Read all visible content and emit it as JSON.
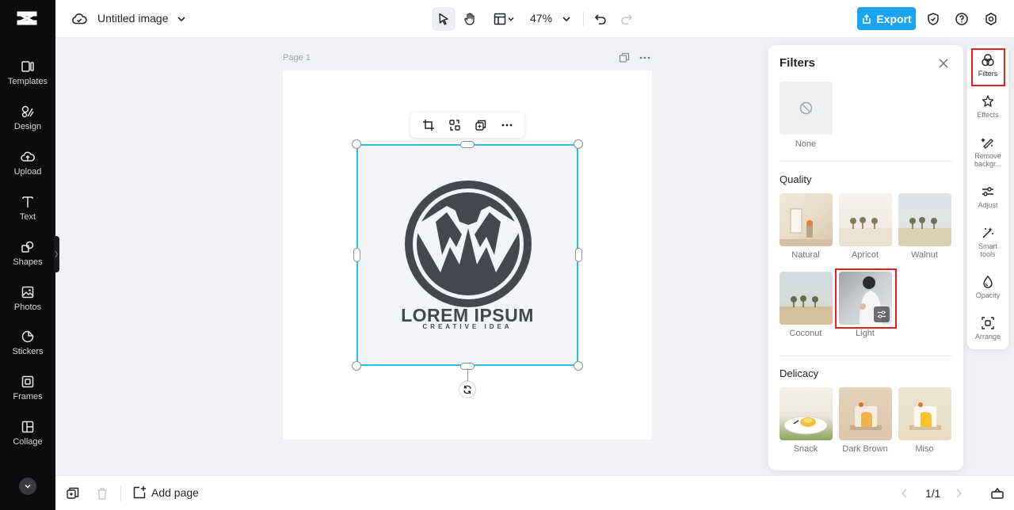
{
  "app": {
    "title": "Untitled image",
    "zoom": "47%",
    "export_label": "Export",
    "accent": "#1ba4f0"
  },
  "sidebar": {
    "items": [
      {
        "label": "Templates",
        "icon": "templates-icon"
      },
      {
        "label": "Design",
        "icon": "design-icon"
      },
      {
        "label": "Upload",
        "icon": "upload-icon"
      },
      {
        "label": "Text",
        "icon": "text-icon"
      },
      {
        "label": "Shapes",
        "icon": "shapes-icon"
      },
      {
        "label": "Photos",
        "icon": "photos-icon"
      },
      {
        "label": "Stickers",
        "icon": "stickers-icon"
      },
      {
        "label": "Frames",
        "icon": "frames-icon"
      },
      {
        "label": "Collage",
        "icon": "collage-icon"
      }
    ]
  },
  "canvas": {
    "page_label": "Page 1",
    "logo_main": "LOREM IPSUM",
    "logo_sub": "CREATIVE IDEA"
  },
  "bottombar": {
    "add_page": "Add page",
    "page_count": "1/1"
  },
  "filters": {
    "title": "Filters",
    "none_label": "None",
    "sections": [
      {
        "title": "Quality",
        "items": [
          "Natural",
          "Apricot",
          "Walnut",
          "Coconut",
          "Light"
        ]
      },
      {
        "title": "Delicacy",
        "items": [
          "Snack",
          "Dark Brown",
          "Miso"
        ]
      }
    ]
  },
  "rail": {
    "items": [
      {
        "label": "Filters",
        "icon": "filters-icon",
        "selected": true
      },
      {
        "label": "Effects",
        "icon": "effects-icon"
      },
      {
        "label": "Remove backgr...",
        "icon": "remove-background-icon"
      },
      {
        "label": "Adjust",
        "icon": "adjust-icon"
      },
      {
        "label": "Smart tools",
        "icon": "smart-tools-icon"
      },
      {
        "label": "Opacity",
        "icon": "opacity-icon"
      },
      {
        "label": "Arrange",
        "icon": "arrange-icon"
      }
    ]
  }
}
